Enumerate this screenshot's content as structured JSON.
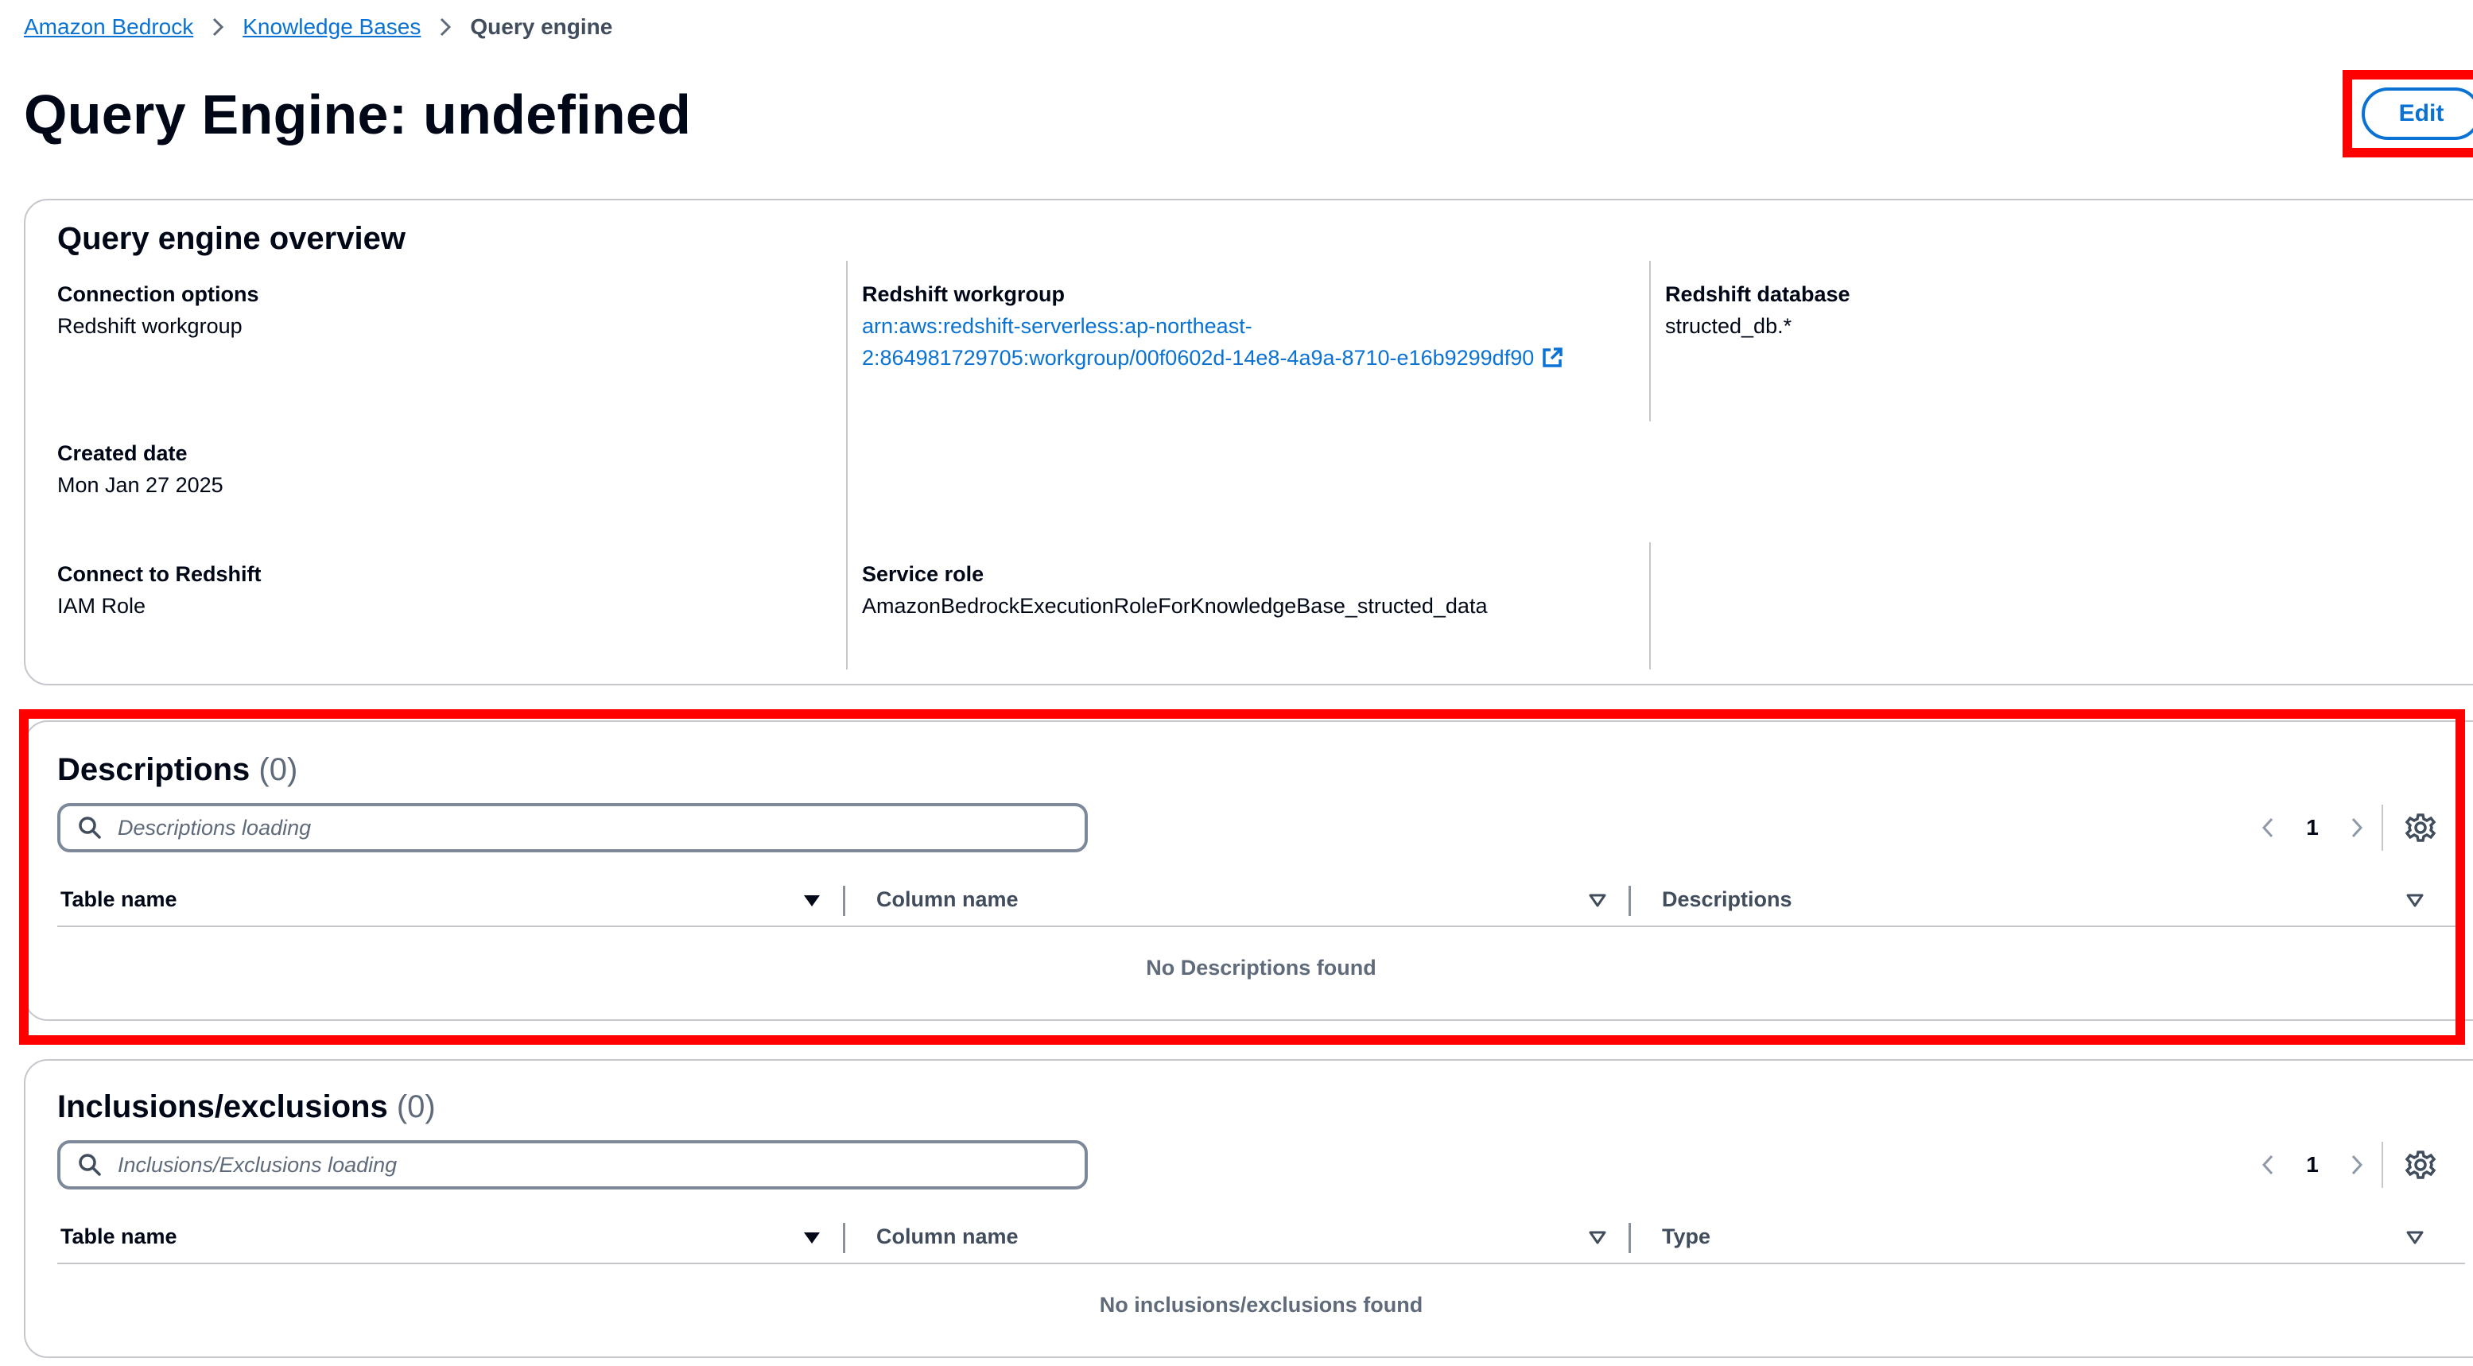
{
  "breadcrumb": {
    "items": [
      "Amazon Bedrock",
      "Knowledge Bases"
    ],
    "current": "Query engine"
  },
  "page": {
    "title": "Query Engine: undefined",
    "edit_label": "Edit"
  },
  "overview": {
    "title": "Query engine overview",
    "connection_options": {
      "label": "Connection options",
      "value": "Redshift workgroup"
    },
    "redshift_workgroup": {
      "label": "Redshift workgroup",
      "value_line1": "arn:aws:redshift-serverless:ap-northeast-",
      "value_line2": "2:864981729705:workgroup/00f0602d-14e8-4a9a-8710-e16b9299df90"
    },
    "redshift_database": {
      "label": "Redshift database",
      "value": "structed_db.*"
    },
    "created_date": {
      "label": "Created date",
      "value": "Mon Jan 27 2025"
    },
    "connect_to_redshift": {
      "label": "Connect to Redshift",
      "value": "IAM Role"
    },
    "service_role": {
      "label": "Service role",
      "value": "AmazonBedrockExecutionRoleForKnowledgeBase_structed_data"
    }
  },
  "descriptions": {
    "title": "Descriptions",
    "count": "(0)",
    "search_placeholder": "Descriptions loading",
    "page": "1",
    "columns": [
      "Table name",
      "Column name",
      "Descriptions"
    ],
    "empty_text": "No Descriptions found"
  },
  "inclusions": {
    "title": "Inclusions/exclusions",
    "count": "(0)",
    "search_placeholder": "Inclusions/Exclusions loading",
    "page": "1",
    "columns": [
      "Table name",
      "Column name",
      "Type"
    ],
    "empty_text": "No inclusions/exclusions found"
  },
  "colors": {
    "link": "#0972d3",
    "text": "#000716",
    "secondary_text": "#5f6b7a",
    "border": "#c6c6cd",
    "highlight": "#ff0000"
  },
  "icons": [
    "chevron-right-icon",
    "external-link-icon",
    "search-icon",
    "chevron-left-icon",
    "settings-gear-icon",
    "sort-caret-filled-icon",
    "sort-caret-outline-icon"
  ]
}
